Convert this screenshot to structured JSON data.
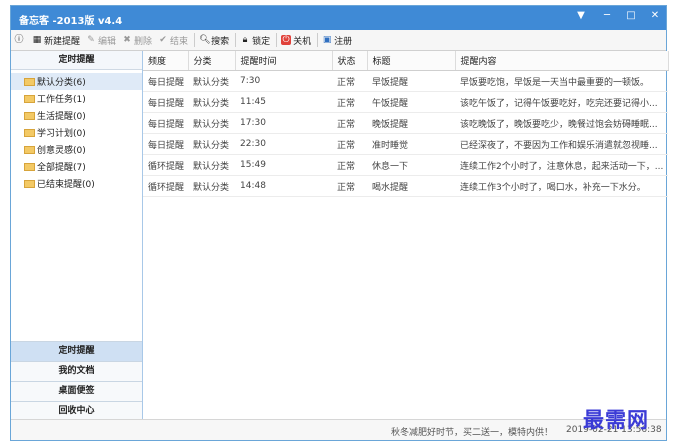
{
  "window": {
    "title": "备忘客 -2013版 v4.4"
  },
  "toolbar": {
    "new": "新建提醒",
    "edit": "编辑",
    "delete": "删除",
    "finish": "结束",
    "search": "搜索",
    "lock": "锁定",
    "shutdown": "关机",
    "register": "注册"
  },
  "sidebar": {
    "header": "定时提醒",
    "categories": [
      {
        "label": "默认分类(6)"
      },
      {
        "label": "工作任务(1)"
      },
      {
        "label": "生活提醒(0)"
      },
      {
        "label": "学习计划(0)"
      },
      {
        "label": "创意灵感(0)"
      },
      {
        "label": "全部提醒(7)"
      },
      {
        "label": "已结束提醒(0)"
      }
    ],
    "nav": [
      "定时提醒",
      "我的文档",
      "桌面便签",
      "回收中心"
    ]
  },
  "table": {
    "headers": [
      "频度",
      "分类",
      "提醒时间",
      "状态",
      "标题",
      "提醒内容"
    ],
    "rows": [
      [
        "每日提醒",
        "默认分类",
        "7:30",
        "正常",
        "早饭提醒",
        "早饭要吃饱，早饭是一天当中最重要的一顿饭。"
      ],
      [
        "每日提醒",
        "默认分类",
        "11:45",
        "正常",
        "午饭提醒",
        "该吃午饭了，记得午饭要吃好，吃完还要记得小..."
      ],
      [
        "每日提醒",
        "默认分类",
        "17:30",
        "正常",
        "晚饭提醒",
        "该吃晚饭了，晚饭要吃少，晚餐过饱会妨碍睡眠..."
      ],
      [
        "每日提醒",
        "默认分类",
        "22:30",
        "正常",
        "准时睡觉",
        "已经深夜了，不要因为工作和娱乐消遣就忽视睡..."
      ],
      [
        "循环提醒",
        "默认分类",
        "15:49",
        "正常",
        "休息一下",
        "连续工作2个小时了，注意休息，起来活动一下，..."
      ],
      [
        "循环提醒",
        "默认分类",
        "14:48",
        "正常",
        "喝水提醒",
        "连续工作3个小时了，喝口水，补充一下水分。"
      ]
    ]
  },
  "status": {
    "message": "秋冬减肥好时节，买二送一，模特内供！",
    "datetime": "2019-02-21 13:56:38"
  },
  "watermark": "最需网"
}
